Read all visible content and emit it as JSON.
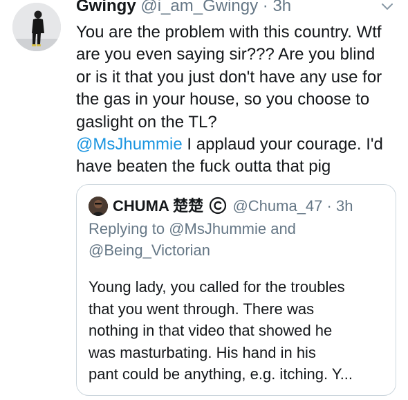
{
  "tweet": {
    "display_name": "Gwingy",
    "handle": "@i_am_Gwingy",
    "separator": "·",
    "time": "3h",
    "icons": {
      "more": "chevron-down-icon"
    },
    "text_lines": [
      "You are the problem with this country. Wtf",
      "are you even saying sir??? Are you blind",
      "or is it that you just don't have any use for",
      "the gas in your house, so you choose to",
      "gaslight on the TL?"
    ],
    "mention": "@MsJhummie",
    "mention_line_rest": " I applaud your courage. I'd",
    "last_line": "have beaten the fuck outta that pig"
  },
  "quoted_tweet": {
    "display_name": "CHUMA 楚楚",
    "handle": "@Chuma_47",
    "separator": "·",
    "time": "3h",
    "icons": {
      "badge": "copyright-icon"
    },
    "replying_prefix": "Replying to ",
    "replying_user_1": "@MsJhummie",
    "replying_joiner": " and",
    "replying_user_2": "@Being_Victorian",
    "text_lines": [
      "Young lady, you called for the troubles",
      "that you went through. There was",
      "nothing in that video that showed he",
      "was masturbating. His hand in his",
      "pant could be anything, e.g. itching. Y..."
    ]
  },
  "colors": {
    "text": "#14171a",
    "secondary": "#657786",
    "link": "#1b95e0",
    "border": "#ccd6dd"
  }
}
